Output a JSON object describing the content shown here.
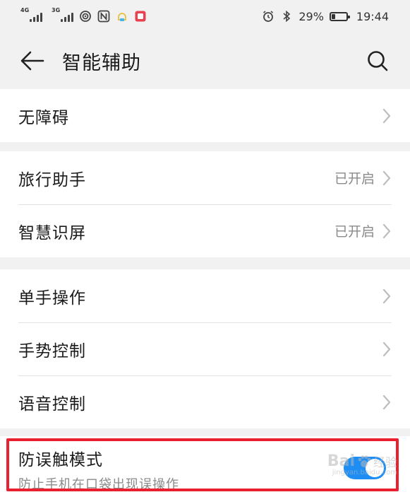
{
  "status_bar": {
    "network_1": "4G",
    "network_2": "3G",
    "battery_text": "29%",
    "battery_level": 0.29,
    "time": "19:44"
  },
  "header": {
    "title": "智能辅助",
    "back_icon": "arrow-left-icon",
    "search_icon": "search-icon"
  },
  "groups": [
    {
      "items": [
        {
          "label": "无障碍",
          "value": ""
        }
      ]
    },
    {
      "items": [
        {
          "label": "旅行助手",
          "value": "已开启"
        },
        {
          "label": "智慧识屏",
          "value": "已开启"
        }
      ]
    },
    {
      "items": [
        {
          "label": "单手操作",
          "value": ""
        },
        {
          "label": "手势控制",
          "value": ""
        },
        {
          "label": "语音控制",
          "value": ""
        }
      ]
    }
  ],
  "toggle_item": {
    "title": "防误触模式",
    "subtitle": "防止手机在口袋出现误操作",
    "enabled": true
  },
  "watermark": {
    "logo_text": "Bai",
    "logo_text_2": "经验",
    "url": "jingyan.baidu.com"
  },
  "colors": {
    "accent": "#1e8ef5",
    "highlight": "#e8202f",
    "background": "#f1f1f1"
  }
}
